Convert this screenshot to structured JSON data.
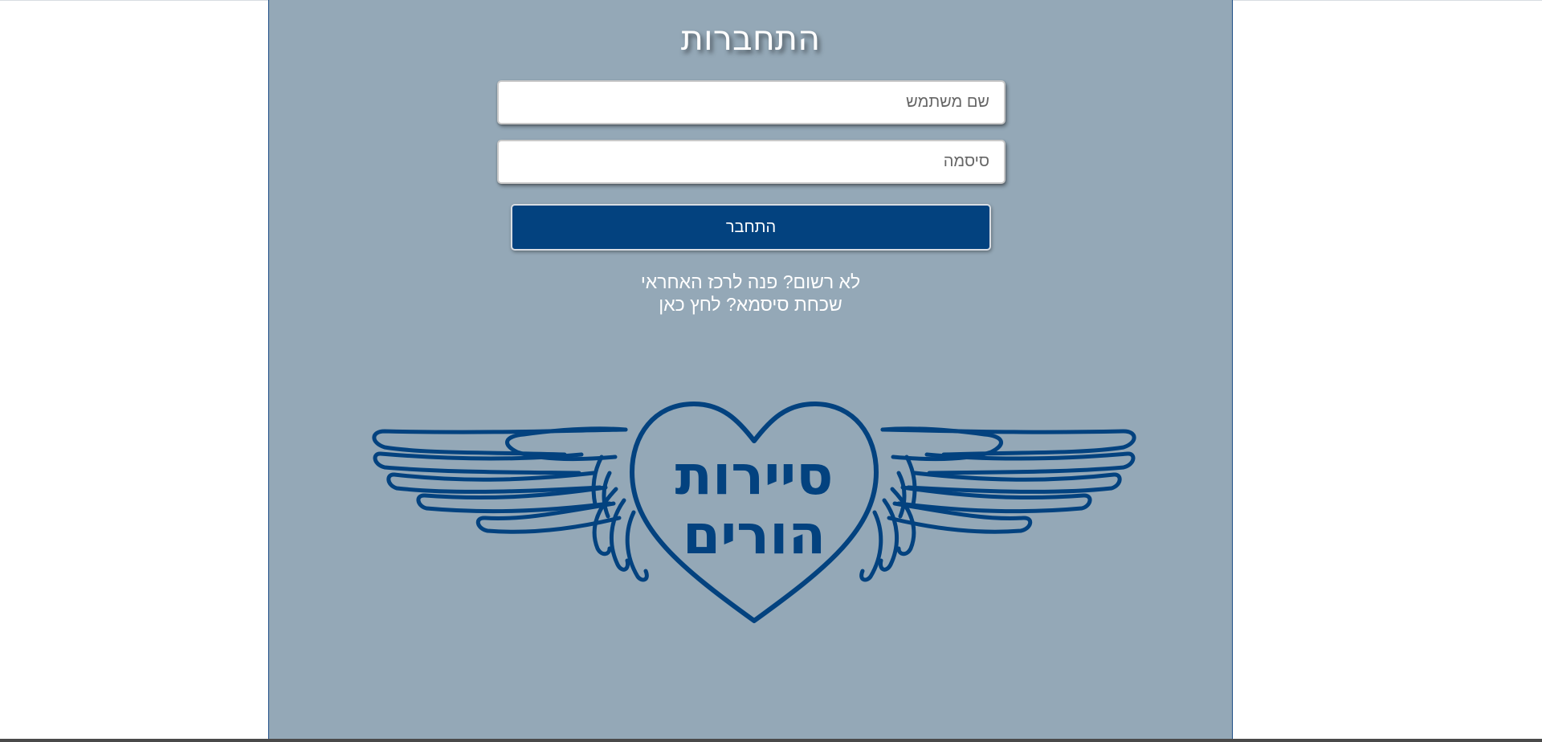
{
  "login": {
    "title": "התחברות",
    "username_placeholder": "שם משתמש",
    "username_value": "",
    "password_placeholder": "סיסמה",
    "password_value": "",
    "submit_label": "התחבר",
    "not_registered_text": "לא רשום? פנה לרכז האחראי",
    "forgot_password_text": "שכחת סיסמא? לחץ כאן"
  },
  "logo": {
    "line1": "סיירות",
    "line2": "הורים",
    "color": "#03427f"
  },
  "colors": {
    "panel_background": "#94a8b7",
    "button_background": "#03427f",
    "page_background": "#ffffff"
  }
}
